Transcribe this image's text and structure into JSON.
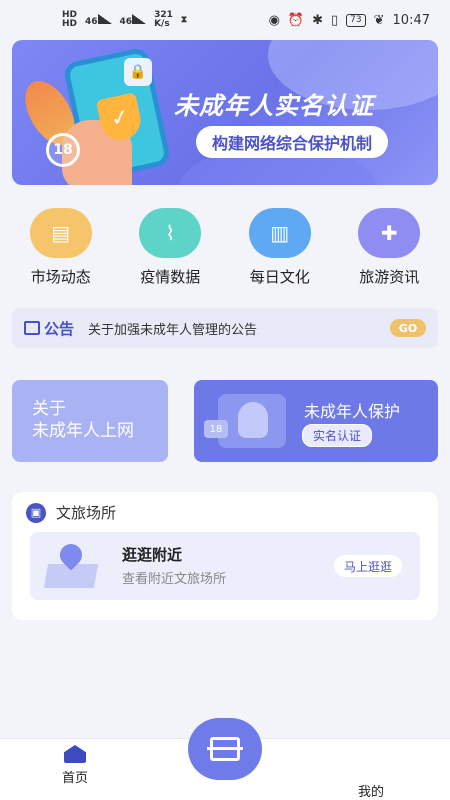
{
  "status_bar": {
    "network_top": "HD",
    "network_bottom": "HD",
    "signal1": "46",
    "signal2": "46",
    "speed": "321",
    "speed_unit": "K/s",
    "battery": "73",
    "time": "10:47"
  },
  "banner": {
    "title": "未成年人实名认证",
    "subtitle": "构建网络综合保护机制",
    "badge": "18"
  },
  "quick_nav": [
    {
      "label": "市场动态",
      "icon": "newspaper-icon",
      "color": "#f5c46b"
    },
    {
      "label": "疫情数据",
      "icon": "chart-icon",
      "color": "#5ed3c8"
    },
    {
      "label": "每日文化",
      "icon": "book-icon",
      "color": "#5fa8f3"
    },
    {
      "label": "旅游资讯",
      "icon": "gamepad-icon",
      "color": "#8f8cf2"
    }
  ],
  "notice": {
    "tag": "公告",
    "text": "关于加强未成年人管理的公告",
    "go": "GO"
  },
  "card_left": {
    "line1": "关于",
    "line2": "未成年人上网"
  },
  "card_right": {
    "title": "未成年人保护",
    "button": "实名认证",
    "badge": "18"
  },
  "places": {
    "title": "文旅场所",
    "item_title": "逛逛附近",
    "item_sub": "查看附近文旅场所",
    "item_button": "马上逛逛"
  },
  "bottom_nav": {
    "home": "首页",
    "mine": "我的"
  }
}
